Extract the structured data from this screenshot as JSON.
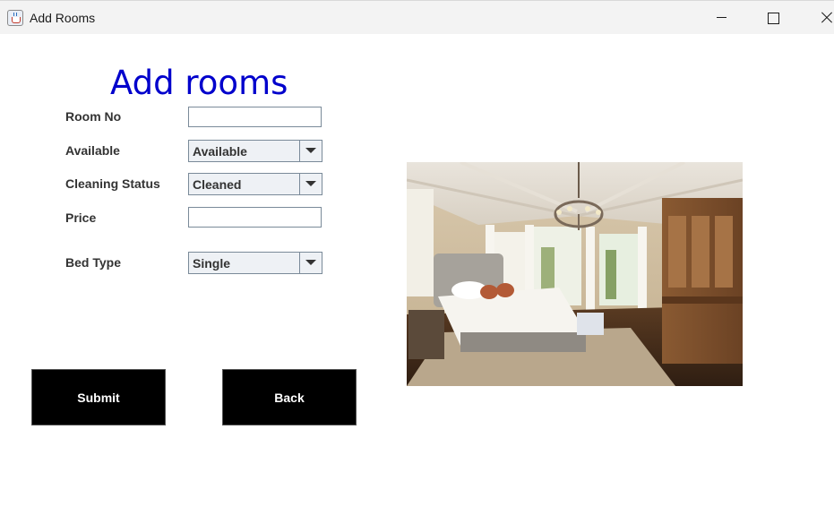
{
  "window": {
    "title": "Add Rooms"
  },
  "form": {
    "heading": "Add rooms",
    "room_no": {
      "label": "Room No",
      "value": ""
    },
    "available": {
      "label": "Available",
      "selected": "Available"
    },
    "cleaning_status": {
      "label": "Cleaning Status",
      "selected": "Cleaned"
    },
    "price": {
      "label": "Price",
      "value": ""
    },
    "bed_type": {
      "label": "Bed Type",
      "selected": "Single"
    }
  },
  "buttons": {
    "submit": "Submit",
    "back": "Back"
  },
  "colors": {
    "heading": "#0000cc",
    "button_bg": "#000000",
    "button_text": "#ffffff"
  },
  "image": {
    "icon": "bedroom-photo"
  }
}
